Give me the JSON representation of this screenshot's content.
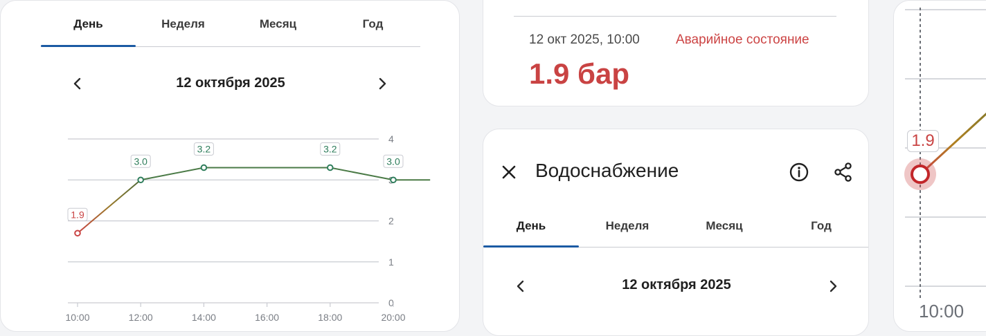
{
  "period_tabs": [
    "День",
    "Неделя",
    "Месяц",
    "Год"
  ],
  "active_tab": "День",
  "date_label": "12 октября 2025",
  "reading": {
    "timestamp": "12 окт 2025, 10:00",
    "status": "Аварийное состояние",
    "value_text": "1.9 бар"
  },
  "detail": {
    "title": "Водоснабжение",
    "tabs": [
      "День",
      "Неделя",
      "Месяц",
      "Год"
    ],
    "date_label": "12 октября 2025"
  },
  "zoom": {
    "tooltip": "1.9",
    "x_label": "10:00"
  },
  "icons": {
    "prev": "chevron-left-icon",
    "next": "chevron-right-icon",
    "close": "close-icon",
    "info": "info-icon",
    "share": "share-icon"
  },
  "colors": {
    "alarm": "#c94343",
    "normal": "#2e7d5b",
    "accent": "#1b5aa3"
  },
  "chart_data": {
    "type": "line",
    "x": [
      "10:00",
      "12:00",
      "14:00",
      "16:00",
      "18:00",
      "20:00"
    ],
    "points": [
      {
        "x": "10:00",
        "y": 1.7,
        "label": "1.9",
        "alarm": true
      },
      {
        "x": "12:00",
        "y": 3.0,
        "label": "3.0",
        "alarm": false
      },
      {
        "x": "14:00",
        "y": 3.3,
        "label": "3.2",
        "alarm": false
      },
      {
        "x": "18:00",
        "y": 3.3,
        "label": "3.2",
        "alarm": false
      },
      {
        "x": "20:00",
        "y": 3.0,
        "label": "3.0",
        "alarm": false
      }
    ],
    "line_end": {
      "x": "21:10",
      "y": 3.0
    },
    "yticks": [
      0,
      1,
      2,
      3,
      4
    ],
    "ylim": [
      0,
      4
    ],
    "grid": true
  }
}
